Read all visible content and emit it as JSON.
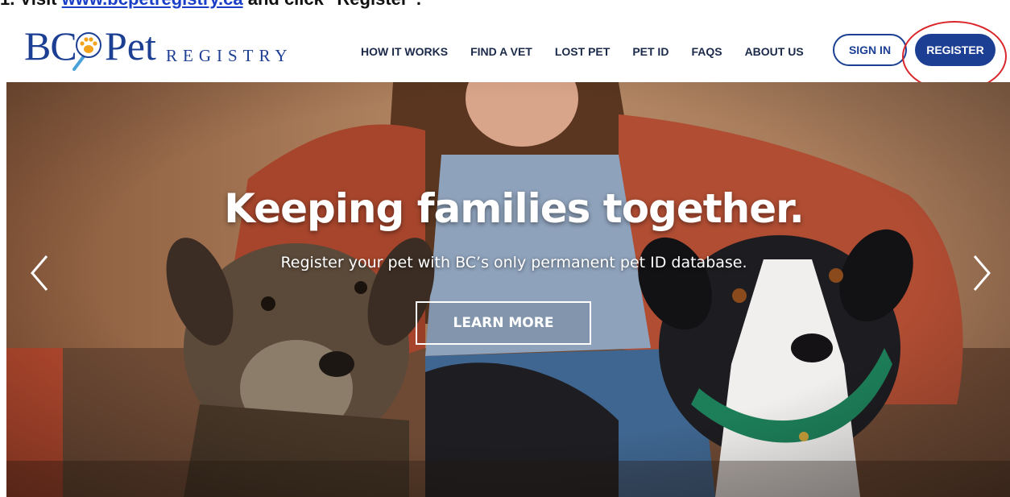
{
  "instruction": {
    "prefix": "1. Visit ",
    "link": "www.bcpetregistry.ca",
    "suffix": " and click \"Register\"."
  },
  "logo": {
    "bc": "BC",
    "pet": "Pet",
    "registry": "REGISTRY"
  },
  "nav": {
    "items": [
      "HOW IT WORKS",
      "FIND A VET",
      "LOST PET",
      "PET ID",
      "FAQS",
      "ABOUT US"
    ],
    "sign_in": "SIGN IN",
    "register": "REGISTER"
  },
  "hero": {
    "title": "Keeping families together.",
    "subtitle": "Register your pet with BC’s only permanent pet ID database.",
    "cta": "LEARN MORE"
  },
  "colors": {
    "brand": "#1c3f94",
    "annotation": "#d9262b",
    "link": "#1a3ec8"
  },
  "icons": {
    "prev": "chevron-left-icon",
    "next": "chevron-right-icon",
    "logo_mark": "paw-magnifier-icon"
  }
}
